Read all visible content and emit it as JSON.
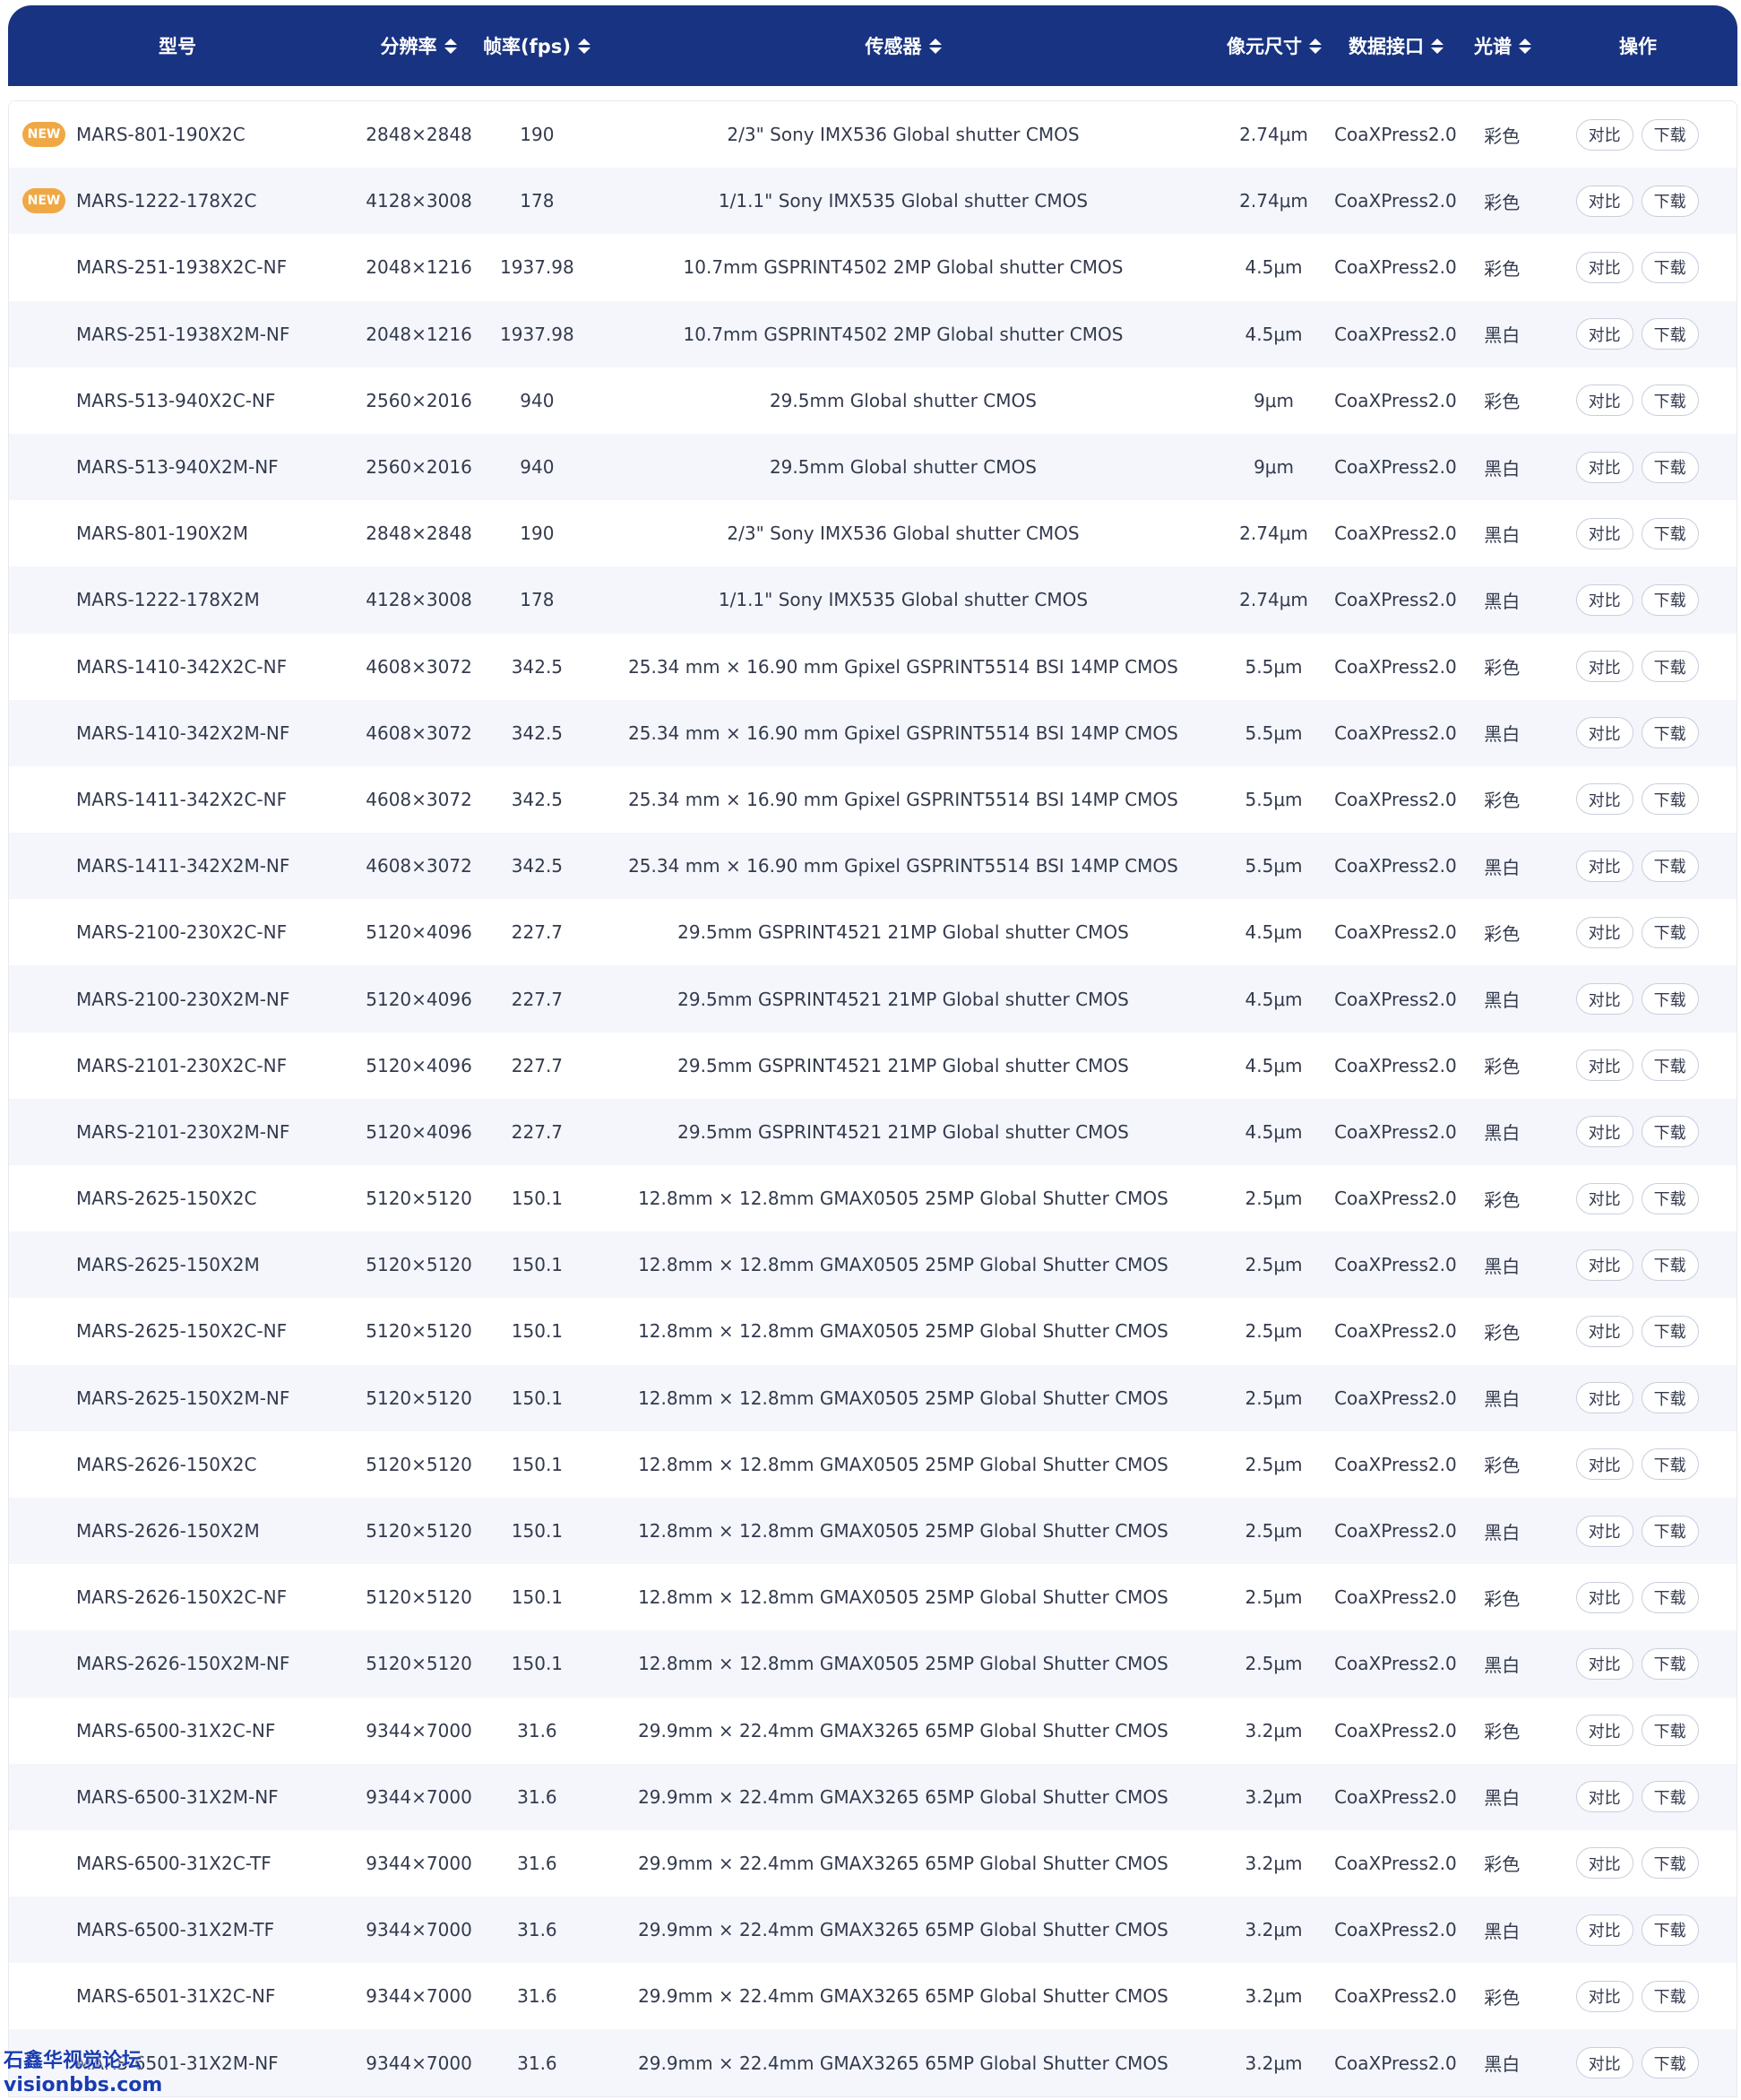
{
  "header": {
    "model": "型号",
    "resolution": "分辨率",
    "fps": "帧率(fps)",
    "sensor": "传感器",
    "pixel_size": "像元尺寸",
    "interface": "数据接口",
    "spectrum": "光谱",
    "actions": "操作"
  },
  "badge_new": "NEW",
  "btn_compare": "对比",
  "btn_download": "下载",
  "colors": {
    "header_bg": "#183381",
    "badge": "#f0a845",
    "stripe": "#f4f6fb"
  },
  "rows": [
    {
      "isNew": true,
      "model": "MARS-801-190X2C",
      "res": "2848×2848",
      "fps": "190",
      "sensor": "2/3\" Sony IMX536 Global shutter CMOS",
      "pix": "2.74μm",
      "if": "CoaXPress2.0",
      "sp": "彩色"
    },
    {
      "isNew": true,
      "model": "MARS-1222-178X2C",
      "res": "4128×3008",
      "fps": "178",
      "sensor": "1/1.1\" Sony IMX535 Global shutter CMOS",
      "pix": "2.74μm",
      "if": "CoaXPress2.0",
      "sp": "彩色"
    },
    {
      "isNew": false,
      "model": "MARS-251-1938X2C-NF",
      "res": "2048×1216",
      "fps": "1937.98",
      "sensor": "10.7mm GSPRINT4502 2MP Global shutter CMOS",
      "pix": "4.5μm",
      "if": "CoaXPress2.0",
      "sp": "彩色"
    },
    {
      "isNew": false,
      "model": "MARS-251-1938X2M-NF",
      "res": "2048×1216",
      "fps": "1937.98",
      "sensor": "10.7mm GSPRINT4502 2MP Global shutter CMOS",
      "pix": "4.5μm",
      "if": "CoaXPress2.0",
      "sp": "黑白"
    },
    {
      "isNew": false,
      "model": "MARS-513-940X2C-NF",
      "res": "2560×2016",
      "fps": "940",
      "sensor": "29.5mm Global shutter CMOS",
      "pix": "9μm",
      "if": "CoaXPress2.0",
      "sp": "彩色"
    },
    {
      "isNew": false,
      "model": "MARS-513-940X2M-NF",
      "res": "2560×2016",
      "fps": "940",
      "sensor": "29.5mm Global shutter CMOS",
      "pix": "9μm",
      "if": "CoaXPress2.0",
      "sp": "黑白"
    },
    {
      "isNew": false,
      "model": "MARS-801-190X2M",
      "res": "2848×2848",
      "fps": "190",
      "sensor": "2/3\" Sony IMX536 Global shutter CMOS",
      "pix": "2.74μm",
      "if": "CoaXPress2.0",
      "sp": "黑白"
    },
    {
      "isNew": false,
      "model": "MARS-1222-178X2M",
      "res": "4128×3008",
      "fps": "178",
      "sensor": "1/1.1\" Sony IMX535 Global shutter CMOS",
      "pix": "2.74μm",
      "if": "CoaXPress2.0",
      "sp": "黑白"
    },
    {
      "isNew": false,
      "model": "MARS-1410-342X2C-NF",
      "res": "4608×3072",
      "fps": "342.5",
      "sensor": "25.34 mm × 16.90 mm Gpixel GSPRINT5514 BSI 14MP CMOS",
      "pix": "5.5μm",
      "if": "CoaXPress2.0",
      "sp": "彩色"
    },
    {
      "isNew": false,
      "model": "MARS-1410-342X2M-NF",
      "res": "4608×3072",
      "fps": "342.5",
      "sensor": "25.34 mm × 16.90 mm Gpixel GSPRINT5514 BSI 14MP CMOS",
      "pix": "5.5μm",
      "if": "CoaXPress2.0",
      "sp": "黑白"
    },
    {
      "isNew": false,
      "model": "MARS-1411-342X2C-NF",
      "res": "4608×3072",
      "fps": "342.5",
      "sensor": "25.34 mm × 16.90 mm Gpixel GSPRINT5514 BSI 14MP CMOS",
      "pix": "5.5μm",
      "if": "CoaXPress2.0",
      "sp": "彩色"
    },
    {
      "isNew": false,
      "model": "MARS-1411-342X2M-NF",
      "res": "4608×3072",
      "fps": "342.5",
      "sensor": "25.34 mm × 16.90 mm Gpixel GSPRINT5514 BSI 14MP CMOS",
      "pix": "5.5μm",
      "if": "CoaXPress2.0",
      "sp": "黑白"
    },
    {
      "isNew": false,
      "model": "MARS-2100-230X2C-NF",
      "res": "5120×4096",
      "fps": "227.7",
      "sensor": "29.5mm GSPRINT4521 21MP Global shutter CMOS",
      "pix": "4.5μm",
      "if": "CoaXPress2.0",
      "sp": "彩色"
    },
    {
      "isNew": false,
      "model": "MARS-2100-230X2M-NF",
      "res": "5120×4096",
      "fps": "227.7",
      "sensor": "29.5mm GSPRINT4521 21MP Global shutter CMOS",
      "pix": "4.5μm",
      "if": "CoaXPress2.0",
      "sp": "黑白"
    },
    {
      "isNew": false,
      "model": "MARS-2101-230X2C-NF",
      "res": "5120×4096",
      "fps": "227.7",
      "sensor": "29.5mm GSPRINT4521 21MP Global shutter CMOS",
      "pix": "4.5μm",
      "if": "CoaXPress2.0",
      "sp": "彩色"
    },
    {
      "isNew": false,
      "model": "MARS-2101-230X2M-NF",
      "res": "5120×4096",
      "fps": "227.7",
      "sensor": "29.5mm GSPRINT4521 21MP Global shutter CMOS",
      "pix": "4.5μm",
      "if": "CoaXPress2.0",
      "sp": "黑白"
    },
    {
      "isNew": false,
      "model": "MARS-2625-150X2C",
      "res": "5120×5120",
      "fps": "150.1",
      "sensor": "12.8mm × 12.8mm GMAX0505 25MP Global Shutter CMOS",
      "pix": "2.5μm",
      "if": "CoaXPress2.0",
      "sp": "彩色"
    },
    {
      "isNew": false,
      "model": "MARS-2625-150X2M",
      "res": "5120×5120",
      "fps": "150.1",
      "sensor": "12.8mm × 12.8mm GMAX0505 25MP Global Shutter CMOS",
      "pix": "2.5μm",
      "if": "CoaXPress2.0",
      "sp": "黑白"
    },
    {
      "isNew": false,
      "model": "MARS-2625-150X2C-NF",
      "res": "5120×5120",
      "fps": "150.1",
      "sensor": "12.8mm × 12.8mm GMAX0505 25MP Global Shutter CMOS",
      "pix": "2.5μm",
      "if": "CoaXPress2.0",
      "sp": "彩色"
    },
    {
      "isNew": false,
      "model": "MARS-2625-150X2M-NF",
      "res": "5120×5120",
      "fps": "150.1",
      "sensor": "12.8mm × 12.8mm GMAX0505 25MP Global Shutter CMOS",
      "pix": "2.5μm",
      "if": "CoaXPress2.0",
      "sp": "黑白"
    },
    {
      "isNew": false,
      "model": "MARS-2626-150X2C",
      "res": "5120×5120",
      "fps": "150.1",
      "sensor": "12.8mm × 12.8mm GMAX0505 25MP Global Shutter CMOS",
      "pix": "2.5μm",
      "if": "CoaXPress2.0",
      "sp": "彩色"
    },
    {
      "isNew": false,
      "model": "MARS-2626-150X2M",
      "res": "5120×5120",
      "fps": "150.1",
      "sensor": "12.8mm × 12.8mm GMAX0505 25MP Global Shutter CMOS",
      "pix": "2.5μm",
      "if": "CoaXPress2.0",
      "sp": "黑白"
    },
    {
      "isNew": false,
      "model": "MARS-2626-150X2C-NF",
      "res": "5120×5120",
      "fps": "150.1",
      "sensor": "12.8mm × 12.8mm GMAX0505 25MP Global Shutter CMOS",
      "pix": "2.5μm",
      "if": "CoaXPress2.0",
      "sp": "彩色"
    },
    {
      "isNew": false,
      "model": "MARS-2626-150X2M-NF",
      "res": "5120×5120",
      "fps": "150.1",
      "sensor": "12.8mm × 12.8mm GMAX0505 25MP Global Shutter CMOS",
      "pix": "2.5μm",
      "if": "CoaXPress2.0",
      "sp": "黑白"
    },
    {
      "isNew": false,
      "model": "MARS-6500-31X2C-NF",
      "res": "9344×7000",
      "fps": "31.6",
      "sensor": "29.9mm × 22.4mm GMAX3265 65MP Global Shutter CMOS",
      "pix": "3.2μm",
      "if": "CoaXPress2.0",
      "sp": "彩色"
    },
    {
      "isNew": false,
      "model": "MARS-6500-31X2M-NF",
      "res": "9344×7000",
      "fps": "31.6",
      "sensor": "29.9mm × 22.4mm GMAX3265 65MP Global Shutter CMOS",
      "pix": "3.2μm",
      "if": "CoaXPress2.0",
      "sp": "黑白"
    },
    {
      "isNew": false,
      "model": "MARS-6500-31X2C-TF",
      "res": "9344×7000",
      "fps": "31.6",
      "sensor": "29.9mm × 22.4mm GMAX3265 65MP Global Shutter CMOS",
      "pix": "3.2μm",
      "if": "CoaXPress2.0",
      "sp": "彩色"
    },
    {
      "isNew": false,
      "model": "MARS-6500-31X2M-TF",
      "res": "9344×7000",
      "fps": "31.6",
      "sensor": "29.9mm × 22.4mm GMAX3265 65MP Global Shutter CMOS",
      "pix": "3.2μm",
      "if": "CoaXPress2.0",
      "sp": "黑白"
    },
    {
      "isNew": false,
      "model": "MARS-6501-31X2C-NF",
      "res": "9344×7000",
      "fps": "31.6",
      "sensor": "29.9mm × 22.4mm GMAX3265 65MP Global Shutter CMOS",
      "pix": "3.2μm",
      "if": "CoaXPress2.0",
      "sp": "彩色"
    },
    {
      "isNew": false,
      "model": "MARS-6501-31X2M-NF",
      "res": "9344×7000",
      "fps": "31.6",
      "sensor": "29.9mm × 22.4mm GMAX3265 65MP Global Shutter CMOS",
      "pix": "3.2μm",
      "if": "CoaXPress2.0",
      "sp": "黑白"
    }
  ],
  "watermark": {
    "line1": "石鑫华视觉论坛",
    "line2": "visionbbs.com"
  }
}
